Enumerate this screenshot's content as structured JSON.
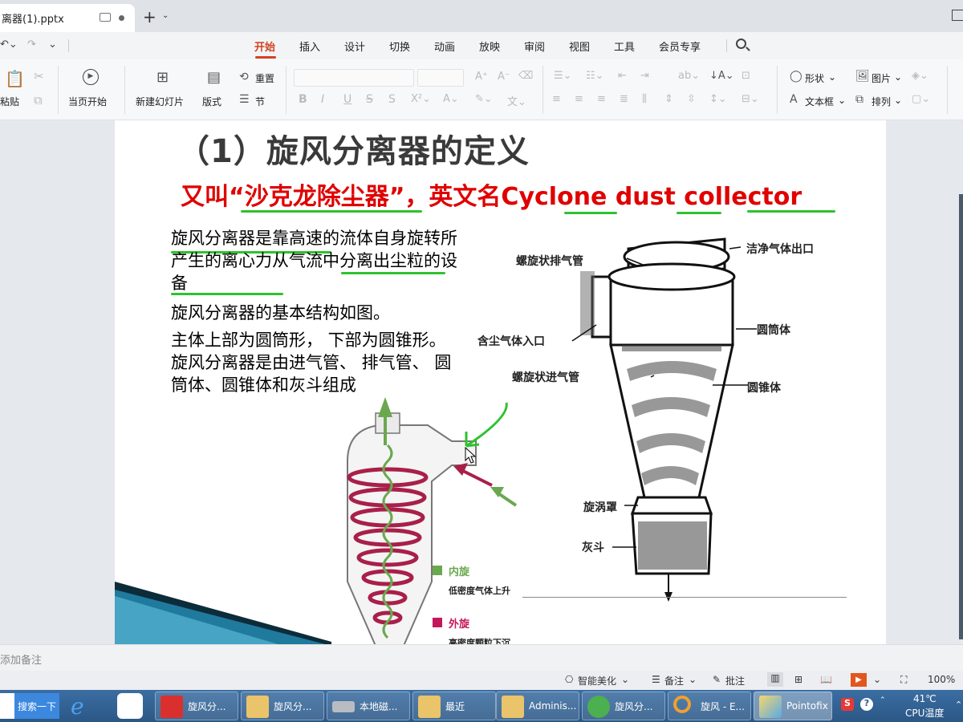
{
  "tabbar": {
    "doc_tab_title": "离器(1).pptx",
    "new_tab": "+",
    "new_tab_arrow": "⌄"
  },
  "menubar": {
    "items": [
      "开始",
      "插入",
      "设计",
      "切换",
      "动画",
      "放映",
      "审阅",
      "视图",
      "工具",
      "会员专享"
    ],
    "active": "开始",
    "quick_undo": "↶⌄",
    "quick_redo": "↷",
    "quick_more": "⌄"
  },
  "ribbon": {
    "paste": "粘贴",
    "play_from_current": "当页开始",
    "new_slide": "新建幻灯片",
    "layout": "版式",
    "reset": "重置",
    "section": "节",
    "shape": "形状",
    "picture": "图片",
    "textbox": "文本框",
    "arrange": "排列",
    "font_bold": "B",
    "font_italic": "I",
    "font_underline": "U",
    "font_strike": "S"
  },
  "slide": {
    "title": "（1）旋风分离器的定义",
    "subtitle": "又叫“沙克龙除尘器”，英文名Cyclone dust collector",
    "body_p1": "旋风分离器是靠高速的流体自身旋转所产生的离心力从气流中分离出尘粒的设备",
    "body_p2": "旋风分离器的基本结构如图。",
    "body_p3": "主体上部为圆筒形， 下部为圆锥形。旋风分离器是由进气管、 排气管、 圆筒体、圆锥体和灰斗组成",
    "diagram_labels": {
      "spiral_exhaust": "螺旋状排气管",
      "clean_gas_outlet": "洁净气体出口",
      "dusty_gas_inlet": "含尘气体入口",
      "cylinder": "圆筒体",
      "spiral_inlet": "螺旋状进气管",
      "cone": "圆锥体",
      "vortex_hood": "旋涡罩",
      "ash_hopper": "灰斗"
    },
    "legend": {
      "inner_title": "内旋",
      "inner_desc": "低密度气体上升",
      "outer_title": "外旋",
      "outer_desc": "高密度颗粒下沉"
    },
    "colors": {
      "title_red": "#e00000",
      "underline_green": "#2ec22e",
      "spiral_red": "#a8204a",
      "spiral_green": "#6aa84f"
    }
  },
  "notes": {
    "placeholder": "添加备注"
  },
  "status": {
    "smart_beautify": "智能美化",
    "notes": "备注",
    "comments": "批注",
    "zoom": "100%"
  },
  "taskbar": {
    "search_button": "搜索一下",
    "apps": [
      {
        "label": "旋风分..."
      },
      {
        "label": "旋风分..."
      },
      {
        "label": "本地磁..."
      },
      {
        "label": "最近"
      },
      {
        "label": "Adminis..."
      },
      {
        "label": "旋风分..."
      },
      {
        "label": "旋风 - E..."
      },
      {
        "label": "Pointofix"
      }
    ],
    "temperature": "41℃",
    "cpu_label": "CPU温度"
  }
}
